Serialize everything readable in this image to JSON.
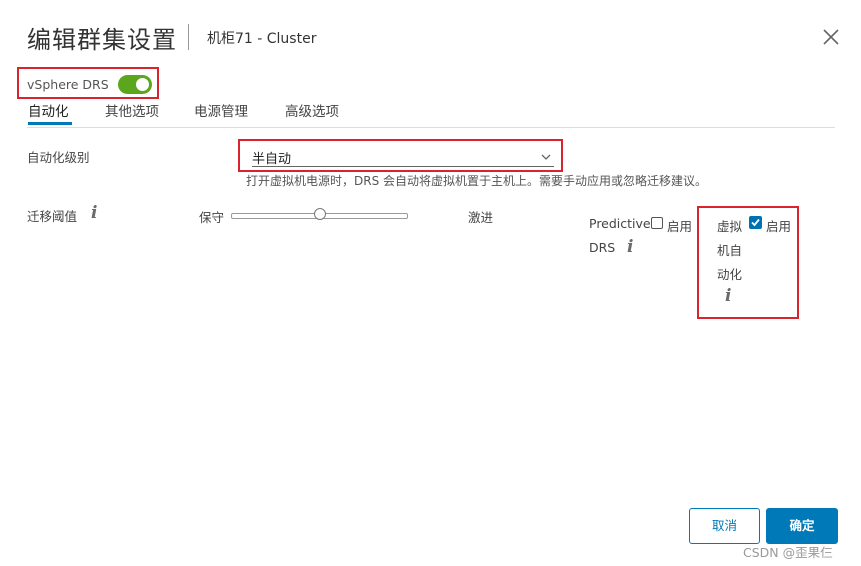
{
  "dialog": {
    "title": "编辑群集设置",
    "subtitle": "机柜71 - Cluster",
    "close_icon": "close-icon"
  },
  "drs": {
    "label": "vSphere DRS",
    "enabled": true
  },
  "tabs": [
    {
      "label": "自动化",
      "active": true
    },
    {
      "label": "其他选项",
      "active": false
    },
    {
      "label": "电源管理",
      "active": false
    },
    {
      "label": "高级选项",
      "active": false
    }
  ],
  "automation": {
    "level_label": "自动化级别",
    "level_value": "半自动",
    "level_hint": "打开虚拟机电源时，DRS 会自动将虚拟机置于主机上。需要手动应用或忽略迁移建议。"
  },
  "migration": {
    "label": "迁移阈值",
    "min_label": "保守",
    "max_label": "激进",
    "level": 3,
    "levels": 5
  },
  "predictive": {
    "label_line1": "Predictive",
    "label_line2": "DRS",
    "checkbox_label": "启用",
    "checked": false
  },
  "vm_automation": {
    "label_line1": "虚拟",
    "label_line2": "机自",
    "label_line3": "动化",
    "checkbox_label": "启用",
    "checked": true
  },
  "info_glyph": "i",
  "footer": {
    "cancel_label": "取消",
    "ok_label": "确定"
  },
  "watermark": "CSDN @歪果仨",
  "colors": {
    "accent": "#0079b8",
    "toggle_on": "#5ca61e",
    "highlight": "#d9232d"
  }
}
